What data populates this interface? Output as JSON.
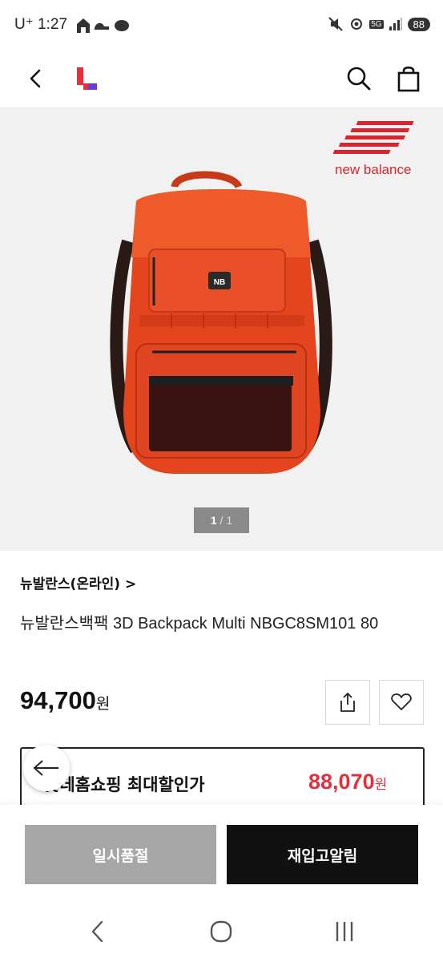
{
  "status_bar": {
    "carrier": "U⁺",
    "time": "1:27",
    "network": "5G",
    "battery": "88"
  },
  "header": {
    "back_icon": "chevron-left-icon",
    "logo_icon": "lotte-l-logo-icon",
    "search_icon": "search-icon",
    "cart_icon": "shopping-bag-icon"
  },
  "gallery": {
    "brand_logo_text": "new balance",
    "current": "1",
    "separator": "/",
    "total": "1"
  },
  "product": {
    "brand": "뉴발란스(온라인)",
    "brand_chevron": ">",
    "title": "뉴발란스백팩 3D Backpack Multi NBGC8SM101 80",
    "price": "94,700",
    "price_unit": "원",
    "share_icon": "share-icon",
    "wishlist_icon": "heart-icon"
  },
  "promo": {
    "label": "롯데홈쇼핑 최대할인가",
    "price": "88,070",
    "price_unit": "원",
    "accent_color": "#e0323c"
  },
  "actions": {
    "soldout_label": "일시품절",
    "restock_label": "재입고알림"
  },
  "system_nav": {
    "back_icon": "nav-back-icon",
    "home_icon": "nav-home-icon",
    "recents_icon": "nav-recents-icon"
  }
}
